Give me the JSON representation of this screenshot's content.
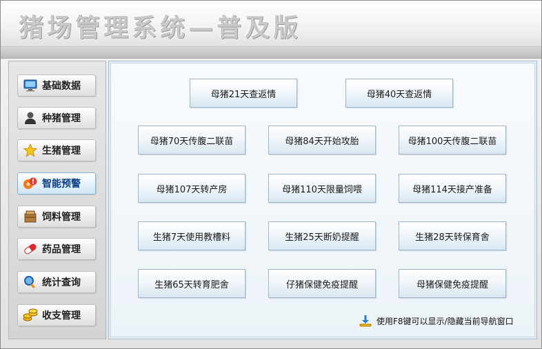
{
  "app": {
    "title": "猪场管理系统—普及版"
  },
  "sidebar": {
    "items": [
      {
        "label": "基础数据",
        "icon": "monitor-icon",
        "active": false
      },
      {
        "label": "种猪管理",
        "icon": "user-icon",
        "active": false
      },
      {
        "label": "生猪管理",
        "icon": "star-icon",
        "active": false
      },
      {
        "label": "智能预警",
        "icon": "alert-icon",
        "active": true
      },
      {
        "label": "饲料管理",
        "icon": "feed-box-icon",
        "active": false
      },
      {
        "label": "药品管理",
        "icon": "pill-icon",
        "active": false
      },
      {
        "label": "统计查询",
        "icon": "magnifier-icon",
        "active": false
      },
      {
        "label": "收支管理",
        "icon": "coins-icon",
        "active": false
      }
    ]
  },
  "main": {
    "alerts": [
      {
        "label": "母猪21天查返情"
      },
      {
        "label": "母猪40天查返情"
      },
      {
        "label": "母猪70天传腹二联苗"
      },
      {
        "label": "母猪84天开始攻胎"
      },
      {
        "label": "母猪100天传腹二联苗"
      },
      {
        "label": "母猪107天转产房"
      },
      {
        "label": "母猪110天限量饲喂"
      },
      {
        "label": "母猪114天接产准备"
      },
      {
        "label": "生猪7天使用教槽料"
      },
      {
        "label": "生猪25天断奶提醒"
      },
      {
        "label": "生猪28天转保育舍"
      },
      {
        "label": "生猪65天转育肥舍"
      },
      {
        "label": "仔猪保健免疫提醒"
      },
      {
        "label": "母猪保健免疫提醒"
      }
    ]
  },
  "footer": {
    "hint": "使用F8键可以显示/隐藏当前导航窗口",
    "hint_icon": "download-arrow-icon"
  },
  "colors": {
    "accent": "#0a3e86",
    "panel_bg": "#ecf3f8"
  }
}
